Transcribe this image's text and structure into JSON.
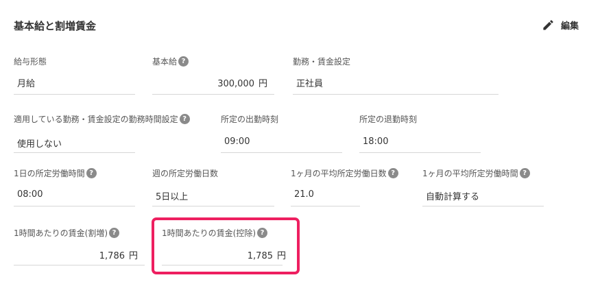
{
  "card": {
    "title": "基本給と割増賃金",
    "edit_label": "編集"
  },
  "help_glyph": "?",
  "fields": {
    "pay_type": {
      "label": "給与形態",
      "value": "月給"
    },
    "base_pay": {
      "label": "基本給",
      "value": "300,000",
      "unit": "円"
    },
    "work_setting": {
      "label": "勤務・賃金設定",
      "value": "正社員"
    },
    "apply_hours": {
      "label": "適用している勤務・賃金設定の勤務時間設定",
      "value": "使用しない"
    },
    "start_time": {
      "label": "所定の出勤時刻",
      "value": "09:00"
    },
    "end_time": {
      "label": "所定の退勤時刻",
      "value": "18:00"
    },
    "daily_hours": {
      "label": "1日の所定労働時間",
      "value": "08:00"
    },
    "weekly_days": {
      "label": "週の所定労働日数",
      "value": "5日以上"
    },
    "monthly_days": {
      "label": "1ヶ月の平均所定労働日数",
      "value": "21.0"
    },
    "monthly_hours": {
      "label": "1ヶ月の平均所定労働時間",
      "value": "自動計算する"
    },
    "hourly_premium": {
      "label": "1時間あたりの賃金(割増)",
      "value": "1,786",
      "unit": "円"
    },
    "hourly_deduct": {
      "label": "1時間あたりの賃金(控除)",
      "value": "1,785",
      "unit": "円"
    }
  }
}
